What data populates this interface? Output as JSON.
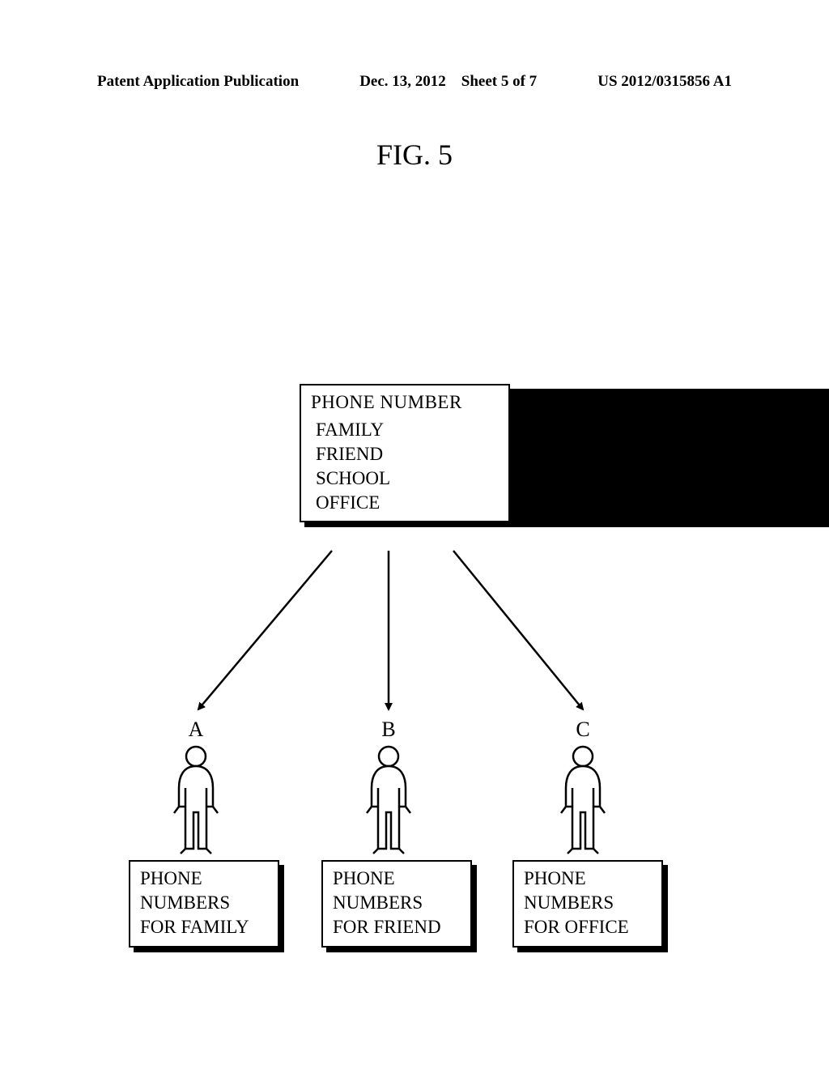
{
  "header": {
    "left": "Patent Application Publication",
    "mid_date": "Dec. 13, 2012",
    "mid_sheet": "Sheet 5 of 7",
    "right": "US 2012/0315856 A1"
  },
  "figure": {
    "title": "FIG. 5"
  },
  "main_box": {
    "title": "PHONE NUMBER",
    "items": [
      "FAMILY",
      "FRIEND",
      "SCHOOL",
      "OFFICE"
    ]
  },
  "children": {
    "a": {
      "label": "A",
      "line1": "PHONE",
      "line2": "NUMBERS",
      "line3": "FOR FAMILY"
    },
    "b": {
      "label": "B",
      "line1": "PHONE",
      "line2": "NUMBERS",
      "line3": "FOR FRIEND"
    },
    "c": {
      "label": "C",
      "line1": "PHONE",
      "line2": "NUMBERS",
      "line3": "FOR OFFICE"
    }
  }
}
